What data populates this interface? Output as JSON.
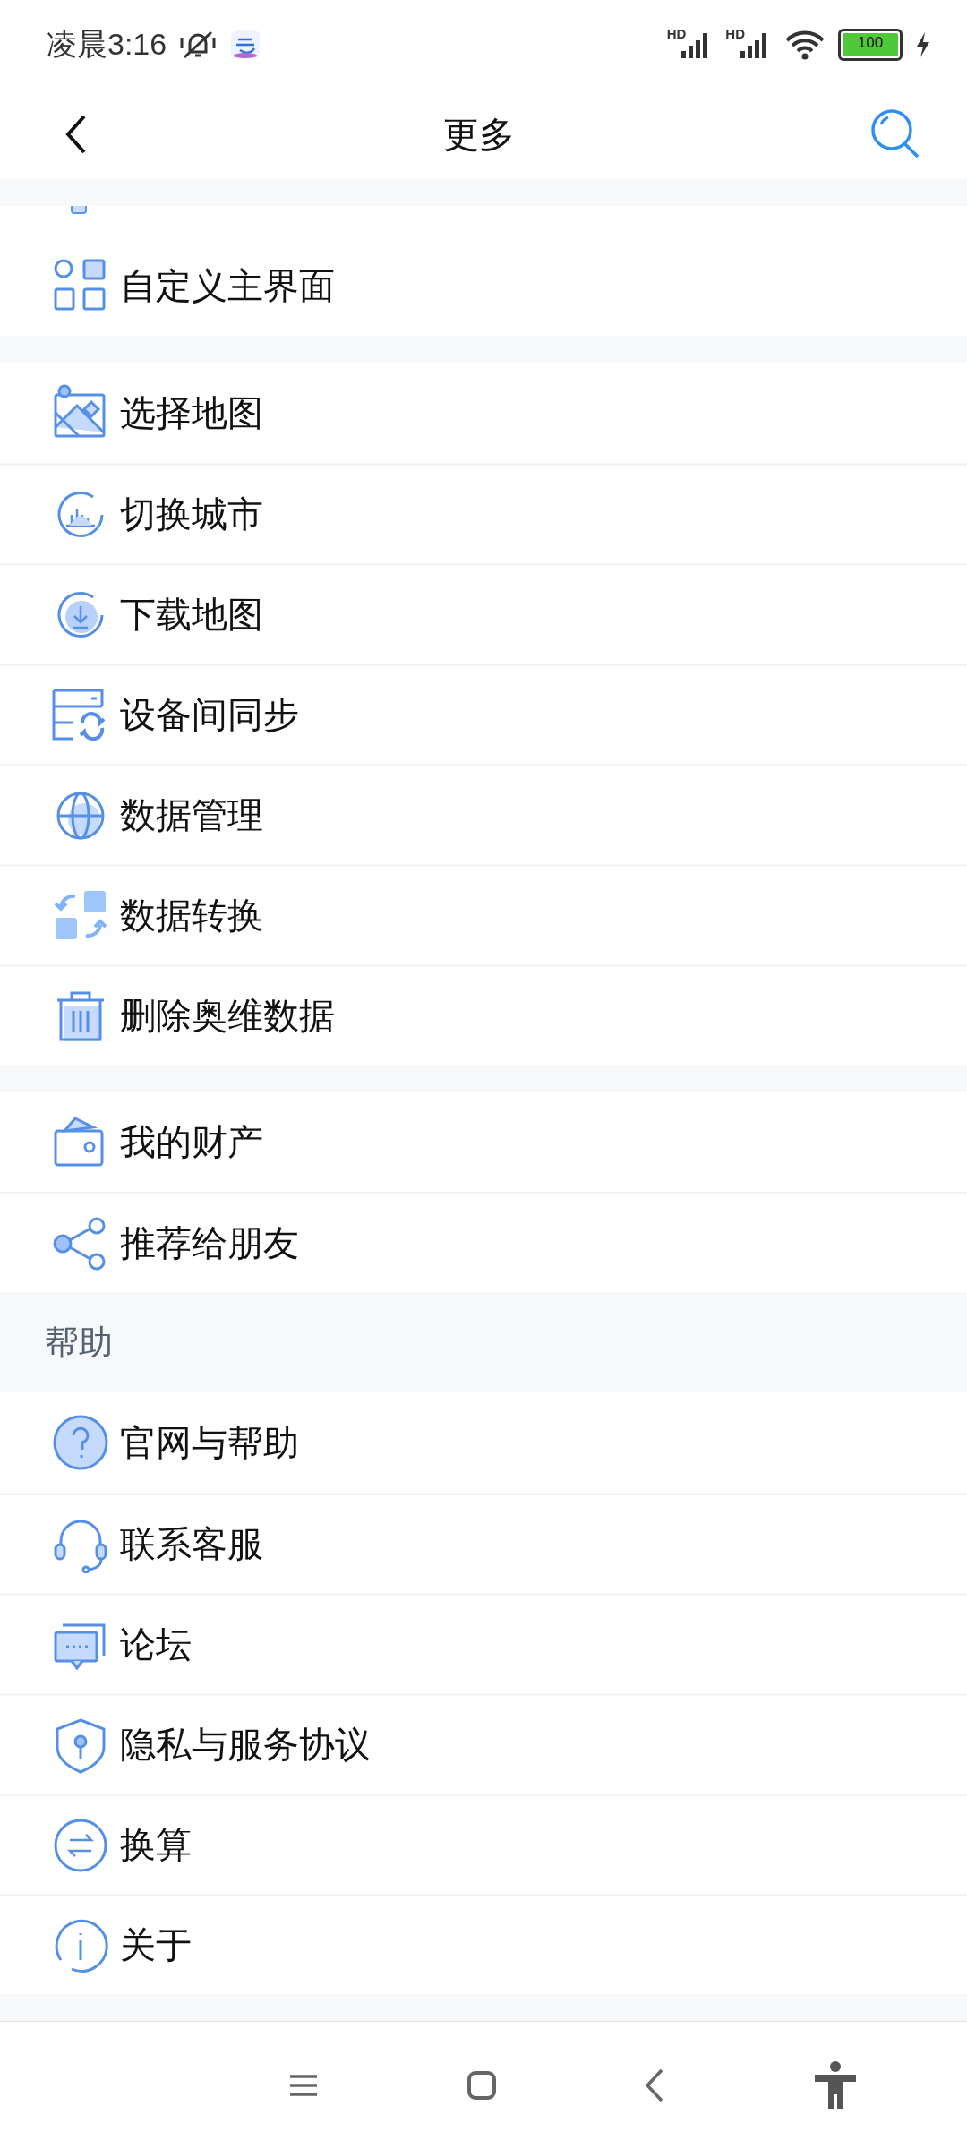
{
  "status_bar": {
    "time": "凌晨3:16",
    "signals": [
      "HD",
      "HD"
    ],
    "battery": "100"
  },
  "header": {
    "title": "更多"
  },
  "groups": [
    {
      "items": [
        {
          "label": "自定义主界面",
          "kind": "grid"
        }
      ]
    },
    {
      "items": [
        {
          "label": "选择地图",
          "kind": "map"
        },
        {
          "label": "切换城市",
          "kind": "city"
        },
        {
          "label": "下载地图",
          "kind": "download"
        },
        {
          "label": "设备间同步",
          "kind": "sync"
        },
        {
          "label": "数据管理",
          "kind": "globe"
        },
        {
          "label": "数据转换",
          "kind": "convert"
        },
        {
          "label": "删除奥维数据",
          "kind": "trash"
        }
      ]
    },
    {
      "items": [
        {
          "label": "我的财产",
          "kind": "wallet"
        },
        {
          "label": "推荐给朋友",
          "kind": "share"
        }
      ]
    },
    {
      "heading": "帮助",
      "items": [
        {
          "label": "官网与帮助",
          "kind": "help"
        },
        {
          "label": "联系客服",
          "kind": "headset"
        },
        {
          "label": "论坛",
          "kind": "chat"
        },
        {
          "label": "隐私与服务协议",
          "kind": "shield"
        },
        {
          "label": "换算",
          "kind": "exchange"
        },
        {
          "label": "关于",
          "kind": "info"
        }
      ]
    }
  ]
}
